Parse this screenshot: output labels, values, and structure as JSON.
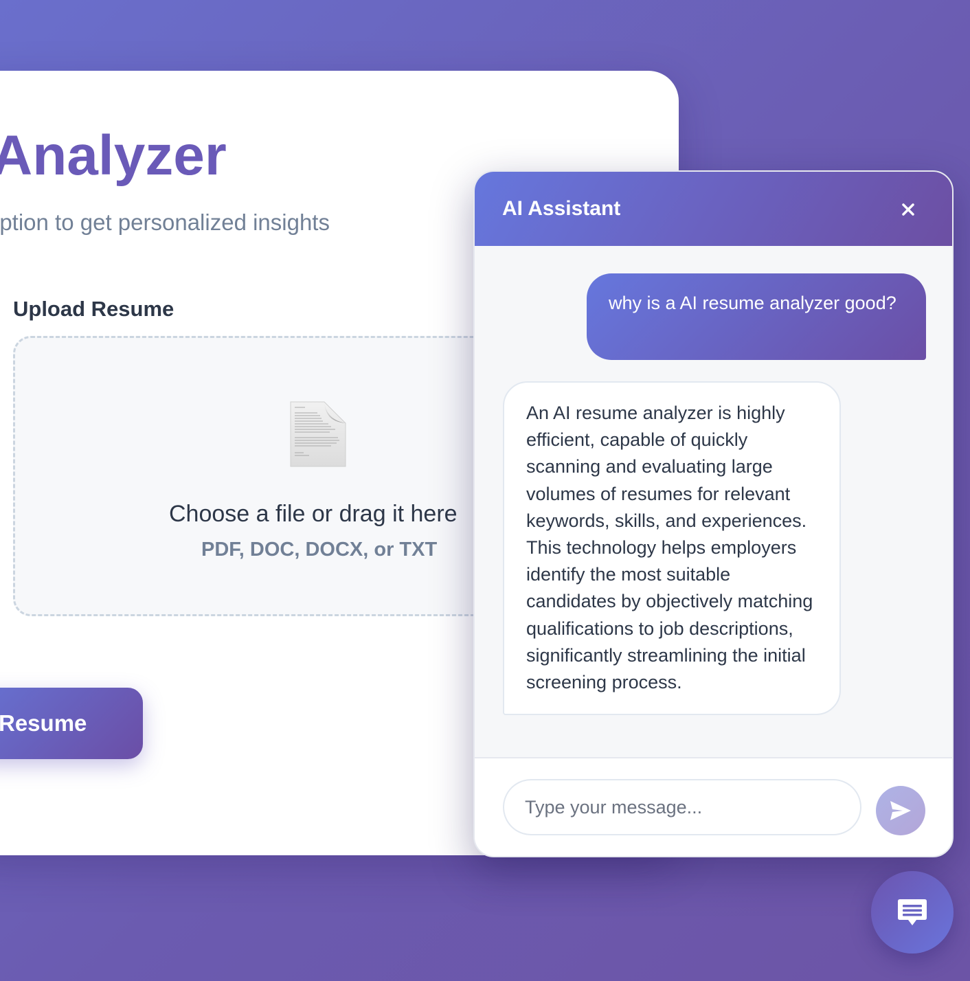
{
  "page": {
    "title": "Analyzer",
    "subtitle": "iption to get personalized insights"
  },
  "upload": {
    "label": "Upload Resume",
    "dropzone_text": "Choose a file or drag it here",
    "dropzone_hint": "PDF, DOC, DOCX, or TXT",
    "icon": "document-icon"
  },
  "analyze_button": {
    "label": "Resume"
  },
  "chat": {
    "title": "AI Assistant",
    "close_icon": "close-icon",
    "messages": [
      {
        "role": "user",
        "text": "why is a AI resume analyzer good?"
      },
      {
        "role": "assistant",
        "text": "An AI resume analyzer is highly efficient, capable of quickly scanning and evaluating large volumes of resumes for relevant keywords, skills, and experiences. This technology helps employers identify the most suitable candidates by objectively matching qualifications to job descriptions, significantly streamlining the initial screening process."
      }
    ],
    "input": {
      "value": "",
      "placeholder": "Type your message..."
    },
    "send_icon": "send-icon"
  },
  "chat_toggle": {
    "icon": "chat-bubble-icon"
  },
  "colors": {
    "accent": "#6a5ab8",
    "gradient_start": "#6677dd",
    "gradient_end": "#6b4fa6",
    "background": "#6b5bb0"
  }
}
